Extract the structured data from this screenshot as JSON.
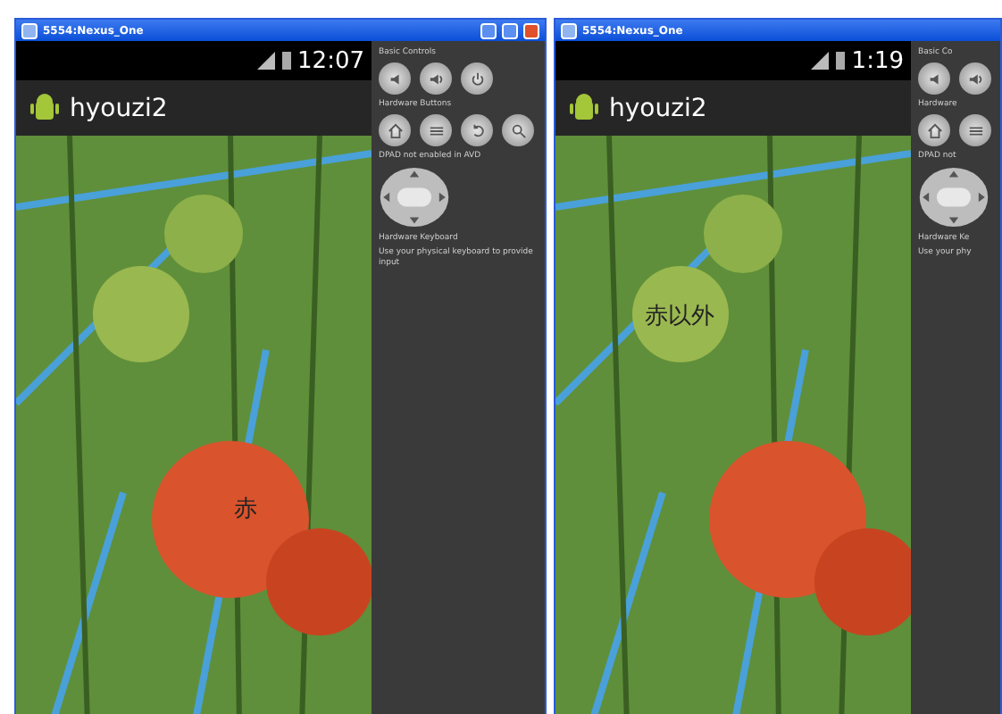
{
  "windows": [
    {
      "title": "5554:Nexus_One",
      "time": "12:07",
      "app_title": "hyouzi2",
      "label": "赤",
      "controls_title": "Basic Controls",
      "buttons_title": "Hardware Buttons",
      "dpad_note": "DPAD not enabled in AVD",
      "keyboard_title": "Hardware Keyboard",
      "keyboard_note": "Use your physical keyboard to provide input"
    },
    {
      "title": "5554:Nexus_One",
      "time": "1:19",
      "app_title": "hyouzi2",
      "label": "赤以外",
      "controls_title": "Basic Co",
      "buttons_title": "Hardware",
      "dpad_note": "DPAD not",
      "keyboard_title": "Hardware Ke",
      "keyboard_note": "Use your phy"
    }
  ]
}
